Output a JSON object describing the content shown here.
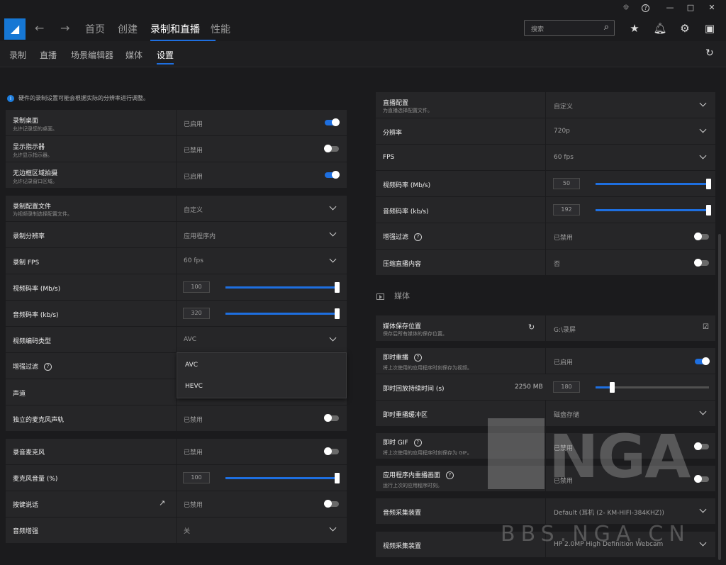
{
  "window": {
    "bug": "☼",
    "help": "?",
    "minimize": "—",
    "maximize": "□",
    "close": "✕"
  },
  "nav": {
    "logo": "◢",
    "back": "←",
    "forward": "→",
    "items": [
      "首页",
      "创建",
      "录制和直播",
      "性能"
    ]
  },
  "search": {
    "placeholder": "搜索"
  },
  "subnav": {
    "items": [
      "录制",
      "直播",
      "场景编辑器",
      "媒体",
      "设置"
    ]
  },
  "info_text": "硬件的录制设置可能会根据实际的分辨率进行调整。",
  "left": {
    "record_desktop": {
      "label": "录制桌面",
      "desc": "允许记录您的桌面。",
      "value": "已启用",
      "toggle": "on"
    },
    "show_indicator": {
      "label": "显示指示器",
      "desc": "允许显示指示器。",
      "value": "已禁用",
      "toggle": "off"
    },
    "borderless": {
      "label": "无边框区域拍摄",
      "desc": "允许记录窗口区域。",
      "value": "已启用",
      "toggle": "on"
    },
    "profile": {
      "label": "录制配置文件",
      "desc": "为视频录制选择配置文件。",
      "value": "自定义"
    },
    "resolution": {
      "label": "录制分辨率",
      "value": "应用程序内"
    },
    "fps": {
      "label": "录制 FPS",
      "value": "60 fps"
    },
    "video_bitrate": {
      "label": "视频码率 (Mb/s)",
      "value": "100",
      "level": 1.0
    },
    "audio_bitrate": {
      "label": "音频码率 (kb/s)",
      "value": "320",
      "level": 1.0
    },
    "codec": {
      "label": "视频编码类型",
      "value": "AVC",
      "options": [
        "AVC",
        "HEVC"
      ]
    },
    "enhance": {
      "label": "增强过滤"
    },
    "channel": {
      "label": "声道"
    },
    "mic_track": {
      "label": "独立的麦克风声轨",
      "value": "已禁用",
      "toggle": "off"
    },
    "record_mic": {
      "label": "录音麦克风",
      "value": "已禁用",
      "toggle": "off"
    },
    "mic_volume": {
      "label": "麦克风音量 (%)",
      "value": "100",
      "level": 1.0
    },
    "ptt": {
      "label": "按键说话",
      "value": "已禁用",
      "toggle": "off"
    },
    "audio_boost": {
      "label": "音频增强",
      "value": "关"
    }
  },
  "right": {
    "stream_profile": {
      "label": "直播配置",
      "desc": "为直播选择配置文件。",
      "value": "自定义"
    },
    "resolution": {
      "label": "分辨率",
      "value": "720p"
    },
    "fps": {
      "label": "FPS",
      "value": "60 fps"
    },
    "video_bitrate": {
      "label": "视频码率 (Mb/s)",
      "value": "50",
      "level": 1.0
    },
    "audio_bitrate": {
      "label": "音频码率 (kb/s)",
      "value": "192",
      "level": 1.0
    },
    "enhance": {
      "label": "增强过滤",
      "value": "已禁用",
      "toggle": "off"
    },
    "compress": {
      "label": "压缩直播内容",
      "value": "否",
      "toggle": "off"
    },
    "section_media": "媒体",
    "save_location": {
      "label": "媒体保存位置",
      "desc": "保存后所有媒体的保存位置。",
      "value": "G:\\录屏"
    },
    "instant_replay": {
      "label": "即时重播",
      "desc": "将上次使用的应用程序时刻保存为视频。",
      "value": "已启用",
      "toggle": "on"
    },
    "replay_duration": {
      "label": "即时回放持续时间 (s)",
      "size": "2250 MB",
      "value": "180",
      "level": 0.15
    },
    "replay_buffer": {
      "label": "即时重播缓冲区",
      "value": "磁盘存储"
    },
    "instant_gif": {
      "label": "即时 GIF",
      "desc": "将上次使用的应用程序时刻保存为 GIF。",
      "value": "已禁用",
      "toggle": "off"
    },
    "in_app_replay": {
      "label": "应用程序内重播画面",
      "desc": "运行上次的应用程序时刻。",
      "value": "已禁用",
      "toggle": "off"
    },
    "audio_device": {
      "label": "音频采集装置",
      "value": "Default (耳机 (2- KM-HIFI-384KHZ))"
    },
    "video_device": {
      "label": "视频采集装置",
      "value": "HP 2.0MP High Definition Webcam"
    }
  },
  "watermark": {
    "text": "NGA",
    "url": "BBS.NGA.CN"
  }
}
